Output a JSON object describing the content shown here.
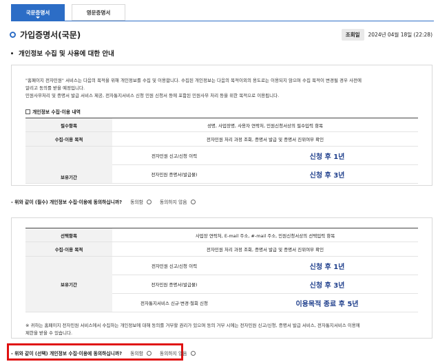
{
  "tabs": [
    {
      "label": "국문증명서",
      "active": true
    },
    {
      "label": "영문증명서",
      "active": false
    }
  ],
  "title": "가입증명서(국문)",
  "inquiry": {
    "label": "조회일",
    "value": "2024년 04월 18일 (22:28)"
  },
  "section_heading": "개인정보 수집 및 사용에 대한 안내",
  "intro_lines": [
    "\"홈페이지 전자민원\" 서비스는 다음의 목적을 위해 개인정보를 수집 및 이용합니다. 수집된 개인정보는 다음의 목적이외의 용도로는 이용되지 않으며 수집 목적이 변경될 경우 사전에",
    "알리고 동의를 받을 예정입니다.",
    "민원사무처리 및 증명서 발급 서비스 제공, 전자통지서비스 신청 민원 신청서 등에 포함된 민원사무 처리 등을 위한 목적으로 이용됩니다."
  ],
  "required_table": {
    "heading": "개인정보 수집·이용 내역",
    "rows": {
      "items_label": "필수항목",
      "items_value": "성명, 사업장명, 사용자 연락처, 민원신청서상의 필수입력 항목",
      "purpose_label": "수집·이용 목적",
      "purpose_value": "전자민원 처리 과정 조회, 증명서 발급 및 증명서 진위여부 확인",
      "retention_label": "보유기간",
      "retention": [
        {
          "item": "전자민원 신고/신청 이력",
          "period": "신청 후 1년"
        },
        {
          "item": "전자민원 증명서(발급물)",
          "period": "신청 후 3년"
        }
      ]
    }
  },
  "agree_required": {
    "question": "- 위와 같이 (필수) 개인정보 수집·이용에 동의하십니까?",
    "agree": "동의함",
    "disagree": "동의하지 않음"
  },
  "optional_table": {
    "rows": {
      "items_label": "선택항목",
      "items_value": "사업장 연락처, E-mail 주소, #-mail 주소, 민원신청서상의 선택입력 항목",
      "purpose_label": "수집·이용 목적",
      "purpose_value": "전자민원 처리 과정 조회, 증명서 발급 및 증명서 진위여부 확인",
      "retention_label": "보유기간",
      "retention": [
        {
          "item": "전자민원 신고/신청 이력",
          "period": "신청 후 1년"
        },
        {
          "item": "전자민원 증명서(발급물)",
          "period": "신청 후 3년"
        },
        {
          "item": "전자통지서비스 신규·변경·철회 신청",
          "period": "이용목적 종료 후 5년"
        }
      ]
    }
  },
  "footnote_lines": [
    "※ 귀하는 홈페이지 전자민원 서비스에서 수집하는 개인정보에 대해 동의를 거부할 권리가 있으며 동의 거부 시에는 전자민원 신고/신청, 증명서 발급 서비스, 전자통지서비스 이용에",
    "제한을 받을 수 있습니다."
  ],
  "agree_optional": {
    "question": "- 위와 같이 (선택) 개인정보 수집·이용에 동의하십니까?",
    "agree": "동의함",
    "disagree": "동의하지 않음"
  },
  "colors": {
    "accent": "#2c6dc6",
    "period_text": "#1f3f8c",
    "highlight": "#e01010"
  }
}
